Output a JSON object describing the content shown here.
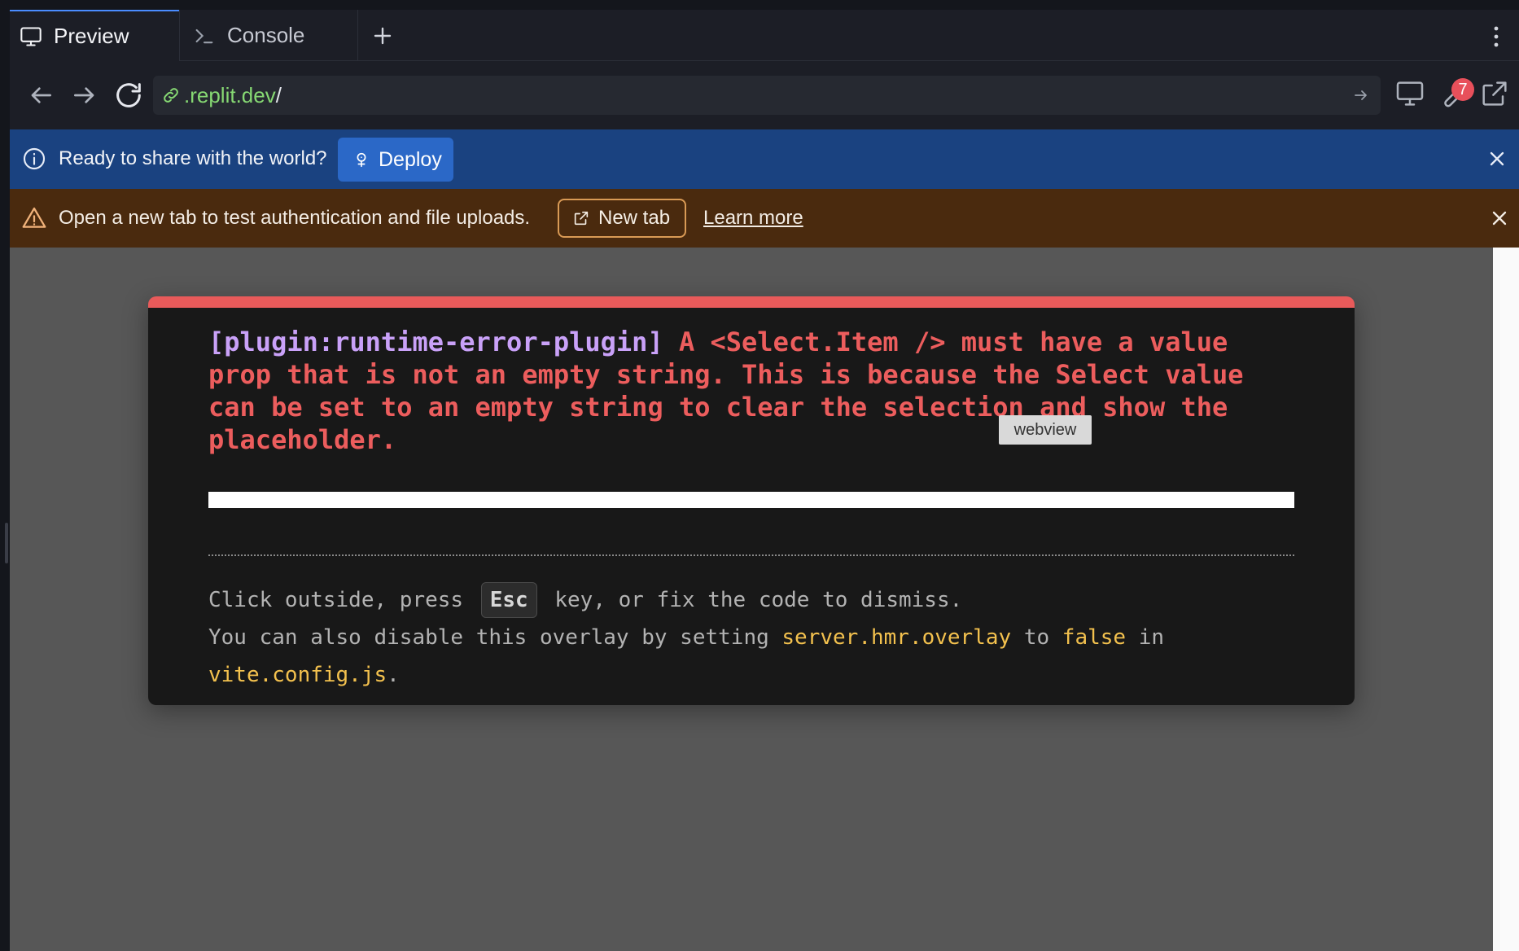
{
  "tabs": [
    {
      "label": "Preview",
      "icon": "monitor-icon",
      "active": true
    },
    {
      "label": "Console",
      "icon": "terminal-icon",
      "active": false
    }
  ],
  "url": {
    "host": ".replit.dev",
    "path": "/"
  },
  "toolbar": {
    "badge_count": "7"
  },
  "deploy_banner": {
    "text": "Ready to share with the world?",
    "button_label": "Deploy"
  },
  "warning_banner": {
    "text": "Open a new tab to test authentication and file uploads.",
    "button_label": "New tab",
    "link_label": "Learn more"
  },
  "error_overlay": {
    "plugin": "[plugin:runtime-error-plugin]",
    "message": "A <Select.Item /> must have a value prop that is not an empty string. This is because the Select value can be set to an empty string to clear the selection and show the placeholder.",
    "tip_part1": "Click outside, press",
    "esc_key": "Esc",
    "tip_part2": "key, or fix the code to dismiss.",
    "tip_line2_part1": "You can also disable this overlay by setting",
    "overlay_setting": "server.hmr.overlay",
    "tip_to": "to",
    "false_value": "false",
    "tip_in": "in",
    "config_file": "vite.config.js",
    "period": "."
  },
  "tooltip": {
    "label": "webview"
  },
  "colors": {
    "deploy_banner": "#1a4280",
    "warning_banner": "#4a2a0e",
    "error_accent": "#e85a5a",
    "plugin_text": "#c9a1f8",
    "code_highlight": "#f3c14e",
    "url_host": "#86d873"
  }
}
